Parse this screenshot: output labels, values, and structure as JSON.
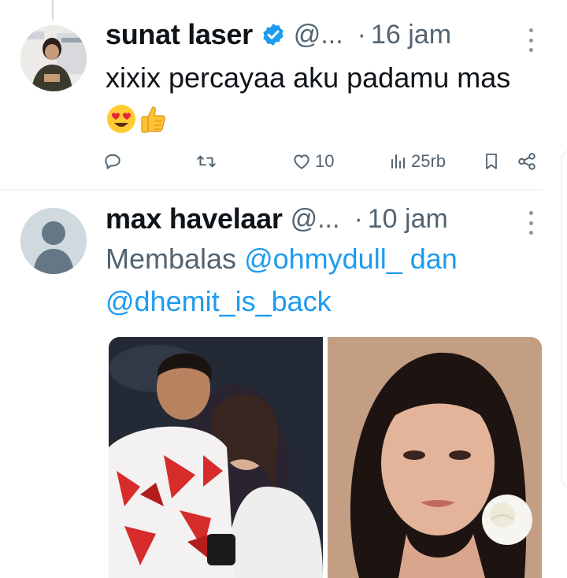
{
  "tweets": [
    {
      "name": "sunat laser",
      "handle": "@...",
      "separator": "·",
      "time": "16 jam",
      "verified": true,
      "text": "xixix percayaa aku padamu mas",
      "emojis": [
        "heart-eyes-emoji",
        "thumbs-up-emoji"
      ],
      "actions": {
        "reply": "",
        "repost": "",
        "like": "10",
        "views": "25rb"
      }
    },
    {
      "name": "max havelaar",
      "handle": "@...",
      "separator": "·",
      "time": "10 jam",
      "verified": false,
      "reply_prefix": "Membalas",
      "mention_1": "@ohmydull_",
      "conjunction": "dan",
      "mention_2": "@dhemit_is_back",
      "media": [
        "photo-couple",
        "photo-woman-portrait"
      ]
    }
  ],
  "colors": {
    "accent": "#1d9bf0",
    "secondary_text": "#536471",
    "primary_text": "#0f1419",
    "divider": "#eff3f4"
  }
}
